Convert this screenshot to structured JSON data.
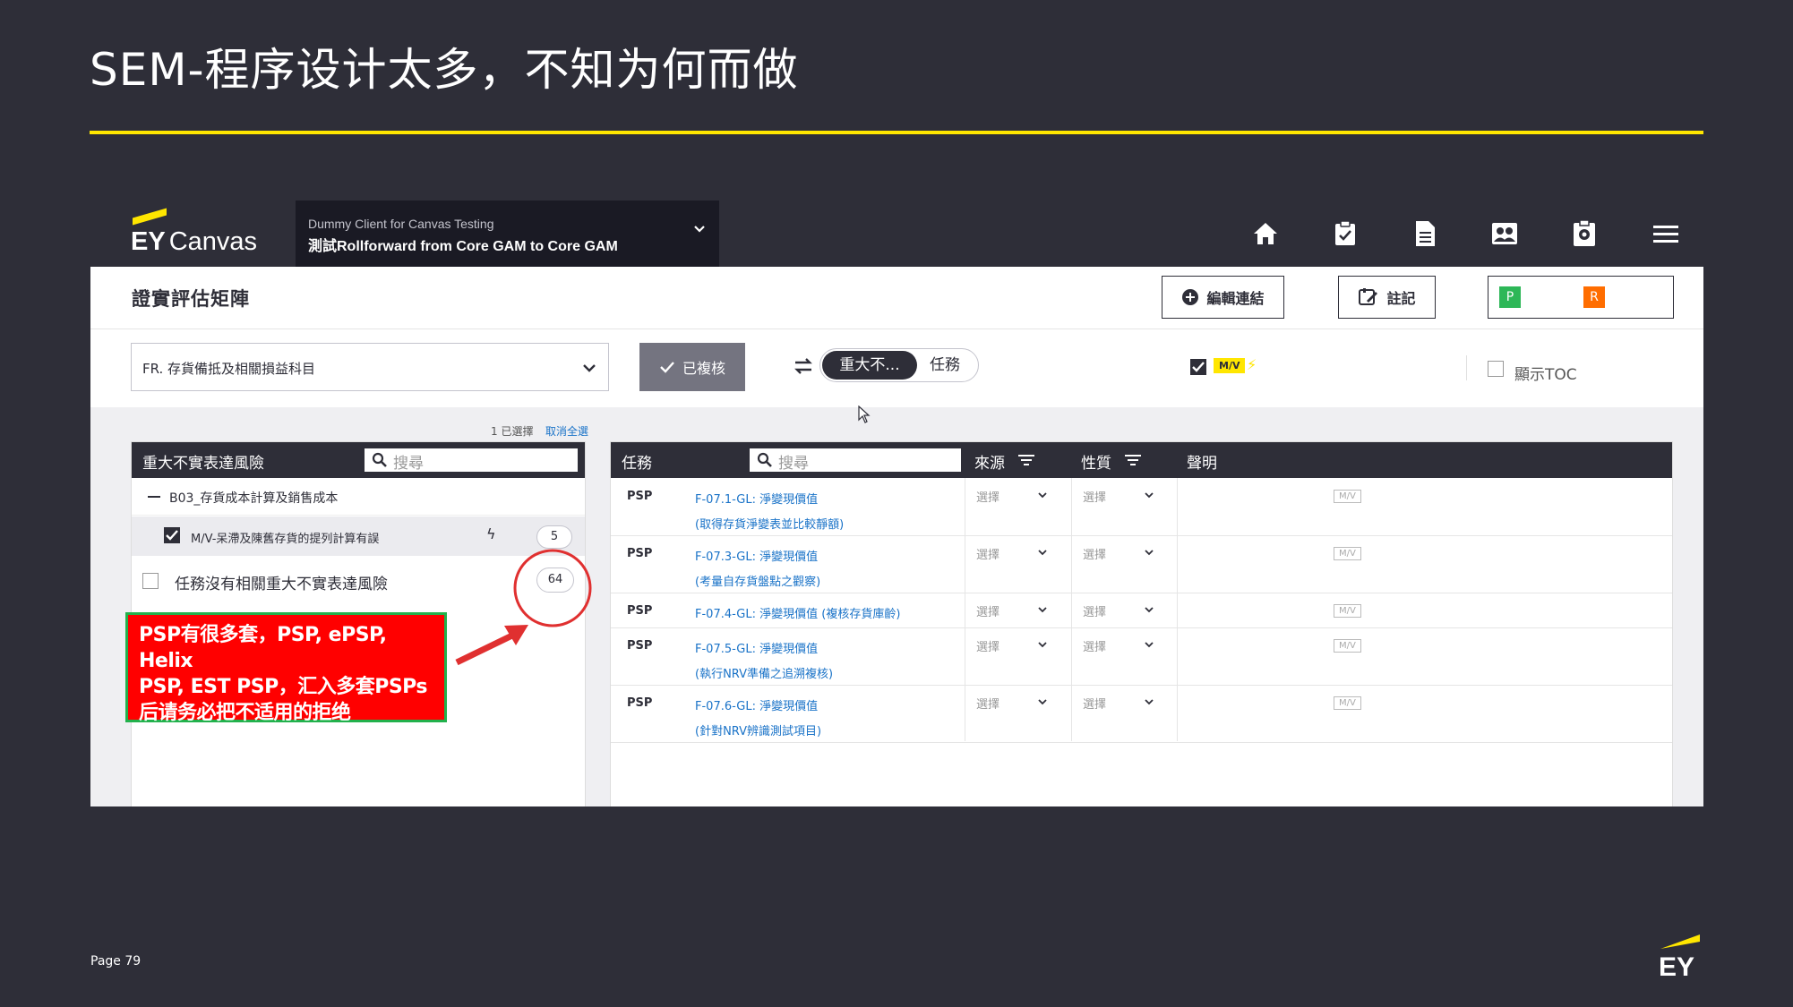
{
  "slide": {
    "title": "SEM-程序设计太多，不知为何而做",
    "page_label": "Page 79"
  },
  "app": {
    "brand": "EY",
    "product": "Canvas",
    "client_small": "Dummy Client for Canvas Testing",
    "client_main": "測試Rollforward from Core GAM to Core GAM",
    "nav_icons": [
      "home-icon",
      "checklist-icon",
      "document-icon",
      "people-icon",
      "settings-icon",
      "menu-icon"
    ]
  },
  "header": {
    "page_title": "證實評估矩陣",
    "edit_link_btn": "編輯連結",
    "note_btn": "註記",
    "badge_p": "P",
    "badge_r": "R"
  },
  "filters": {
    "account_select": "FR. 存貨備抵及相關損益科目",
    "reviewed_btn": "已複核",
    "toggle_active": "重大不...",
    "toggle_inactive": "任務",
    "mv_tag": "M/V",
    "show_toc_label": "顯示TOC"
  },
  "left_panel": {
    "selection_count": "1 已選擇",
    "deselect_all": "取消全選",
    "header": "重大不實表達風險",
    "search_placeholder": "搜尋",
    "group_label": "B03_存貨成本計算及銷售成本",
    "risk_item": "M/V-呆滯及陳舊存貨的提列計算有誤",
    "risk_count": "5",
    "no_risk_label": "任務沒有相關重大不實表達風險",
    "no_risk_count": "64"
  },
  "callout": {
    "line1": "PSP有很多套，PSP, ePSP, Helix",
    "line2": "PSP, EST PSP，汇入多套PSPs",
    "line3": "后请务必把不适用的拒绝"
  },
  "right_panel": {
    "col_task": "任務",
    "search_placeholder": "搜尋",
    "col_source": "來源",
    "col_nature": "性質",
    "col_statement": "聲明",
    "select_placeholder": "選擇",
    "mv_label": "M/V",
    "rows": [
      {
        "type": "PSP",
        "line1": "F-07.1-GL: 淨變現價值",
        "line2": "(取得存貨淨變表並比較靜額)"
      },
      {
        "type": "PSP",
        "line1": "F-07.3-GL: 淨變現價值",
        "line2": "(考量自存貨盤點之觀察)"
      },
      {
        "type": "PSP",
        "line1": "F-07.4-GL: 淨變現價值 (複核存貨庫齡)",
        "line2": ""
      },
      {
        "type": "PSP",
        "line1": "F-07.5-GL: 淨變現價值",
        "line2": "(執行NRV準備之追溯複核)"
      },
      {
        "type": "PSP",
        "line1": "F-07.6-GL: 淨變現價值",
        "line2": "(針對NRV辨識測試項目)"
      }
    ]
  },
  "colors": {
    "background": "#2e2e38",
    "accent_yellow": "#ffe600",
    "link_blue": "#1a73c8",
    "callout_red": "#ff0000",
    "callout_border_green": "#22b14c",
    "badge_p_green": "#2db757",
    "badge_r_orange": "#ff6d00"
  }
}
